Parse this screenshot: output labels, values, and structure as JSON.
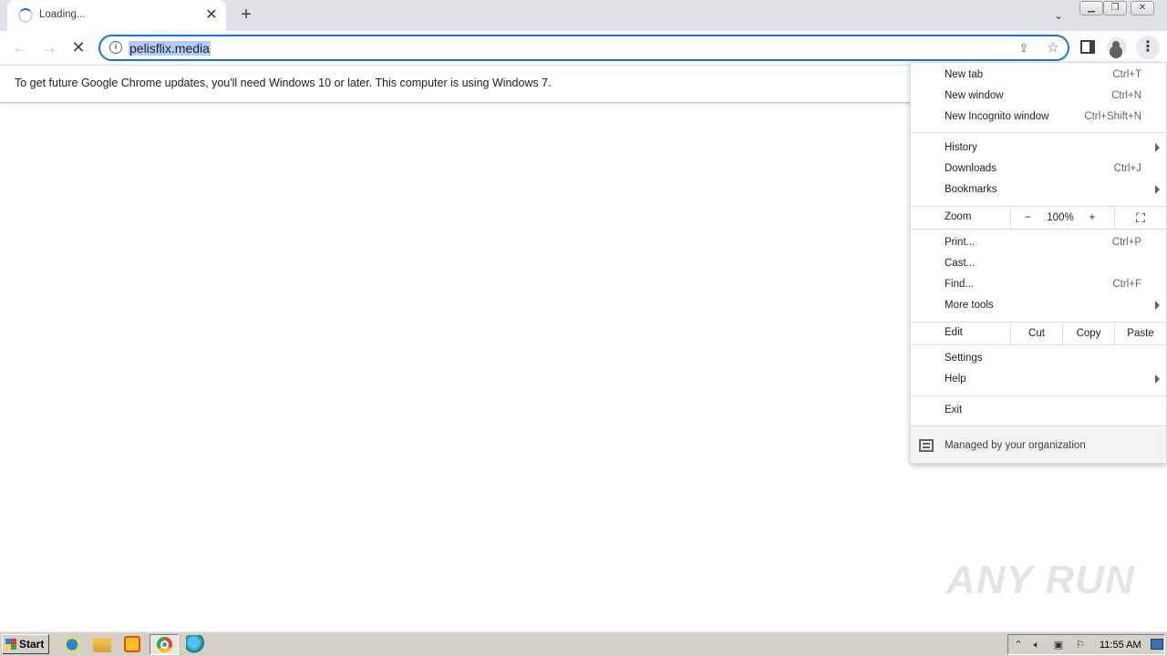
{
  "browser": {
    "tab": {
      "title": "Loading..."
    },
    "omnibox": {
      "url": "pelisflix.media"
    }
  },
  "infobar": {
    "text": "To get future Google Chrome updates, you'll need Windows 10 or later. This computer is using Windows 7."
  },
  "menu": {
    "new_tab": {
      "label": "New tab",
      "shortcut": "Ctrl+T"
    },
    "new_window": {
      "label": "New window",
      "shortcut": "Ctrl+N"
    },
    "new_incognito": {
      "label": "New Incognito window",
      "shortcut": "Ctrl+Shift+N"
    },
    "history": {
      "label": "History"
    },
    "downloads": {
      "label": "Downloads",
      "shortcut": "Ctrl+J"
    },
    "bookmarks": {
      "label": "Bookmarks"
    },
    "zoom": {
      "label": "Zoom",
      "minus": "−",
      "level": "100%",
      "plus": "+"
    },
    "print": {
      "label": "Print...",
      "shortcut": "Ctrl+P"
    },
    "cast": {
      "label": "Cast..."
    },
    "find": {
      "label": "Find...",
      "shortcut": "Ctrl+F"
    },
    "more_tools": {
      "label": "More tools"
    },
    "edit": {
      "label": "Edit",
      "cut": "Cut",
      "copy": "Copy",
      "paste": "Paste"
    },
    "settings": {
      "label": "Settings"
    },
    "help": {
      "label": "Help"
    },
    "exit": {
      "label": "Exit"
    },
    "managed": {
      "label": "Managed by your organization"
    }
  },
  "watermark": {
    "text": "ANY RUN"
  },
  "taskbar": {
    "start_label": "Start",
    "clock": "11:55 AM"
  },
  "colors": {
    "accent": "#1a73e8",
    "tabstrip": "#dee1e6",
    "taskbar": "#d4d0c8",
    "url_highlight": "#b3cdfa"
  }
}
